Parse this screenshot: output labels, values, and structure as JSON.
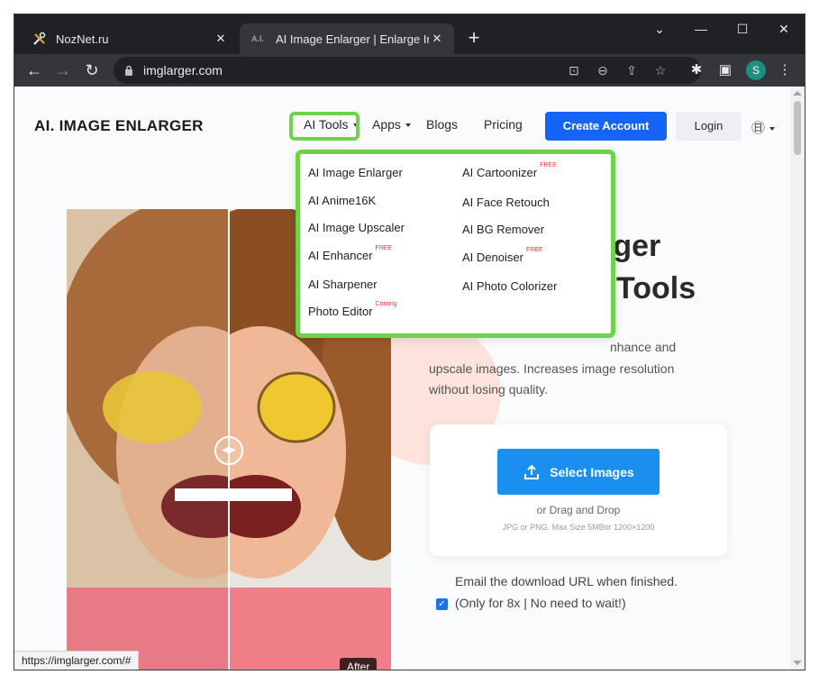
{
  "browser": {
    "tabs": [
      {
        "title": "NozNet.ru",
        "active": false,
        "icon": "tools-icon"
      },
      {
        "title": "AI Image Enlarger | Enlarge Imag",
        "active": true,
        "icon": "ai-logo-icon",
        "favicon_text": "A.I."
      }
    ],
    "url": "imglarger.com",
    "profile_initial": "S",
    "status_url": "https://imglarger.com/#"
  },
  "site": {
    "brand": "AI. IMAGE ENLARGER",
    "nav": {
      "ai_tools": "AI Tools",
      "apps": "Apps",
      "blogs": "Blogs",
      "pricing": "Pricing",
      "create_account": "Create Account",
      "login": "Login"
    },
    "dropdown": {
      "left": [
        {
          "label": "AI Image Enlarger",
          "tag": ""
        },
        {
          "label": "AI Anime16K",
          "tag": ""
        },
        {
          "label": "AI Image Upscaler",
          "tag": ""
        },
        {
          "label": "AI Enhancer",
          "tag": "FREE"
        },
        {
          "label": "AI Sharpener",
          "tag": ""
        },
        {
          "label": "Photo Editor",
          "tag": "Coming"
        }
      ],
      "right": [
        {
          "label": "AI Cartoonizer",
          "tag": "FREE"
        },
        {
          "label": "AI Face Retouch",
          "tag": ""
        },
        {
          "label": "AI BG Remover",
          "tag": ""
        },
        {
          "label": "AI Denoiser",
          "tag": "FREE"
        },
        {
          "label": "AI Photo Colorizer",
          "tag": ""
        }
      ]
    },
    "hero": {
      "title_line1": "nlarger",
      "title_line2": "Tools",
      "desc_line1": "nhance and",
      "desc_line2": "upscale images. Increases image resolution",
      "desc_line3": "without losing quality."
    },
    "upload": {
      "button": "Select Images",
      "drag": "or Drag and Drop",
      "info": "JPG or PNG. Max Size 5MBor 1200×1200"
    },
    "email_note": "Email the download URL when finished.",
    "checkbox_label": "(Only for 8x | No need to wait!)",
    "checkbox_checked": true,
    "compare_label_after": "After",
    "accent_color": "#1664f5",
    "highlight_color": "#6cd34b"
  }
}
